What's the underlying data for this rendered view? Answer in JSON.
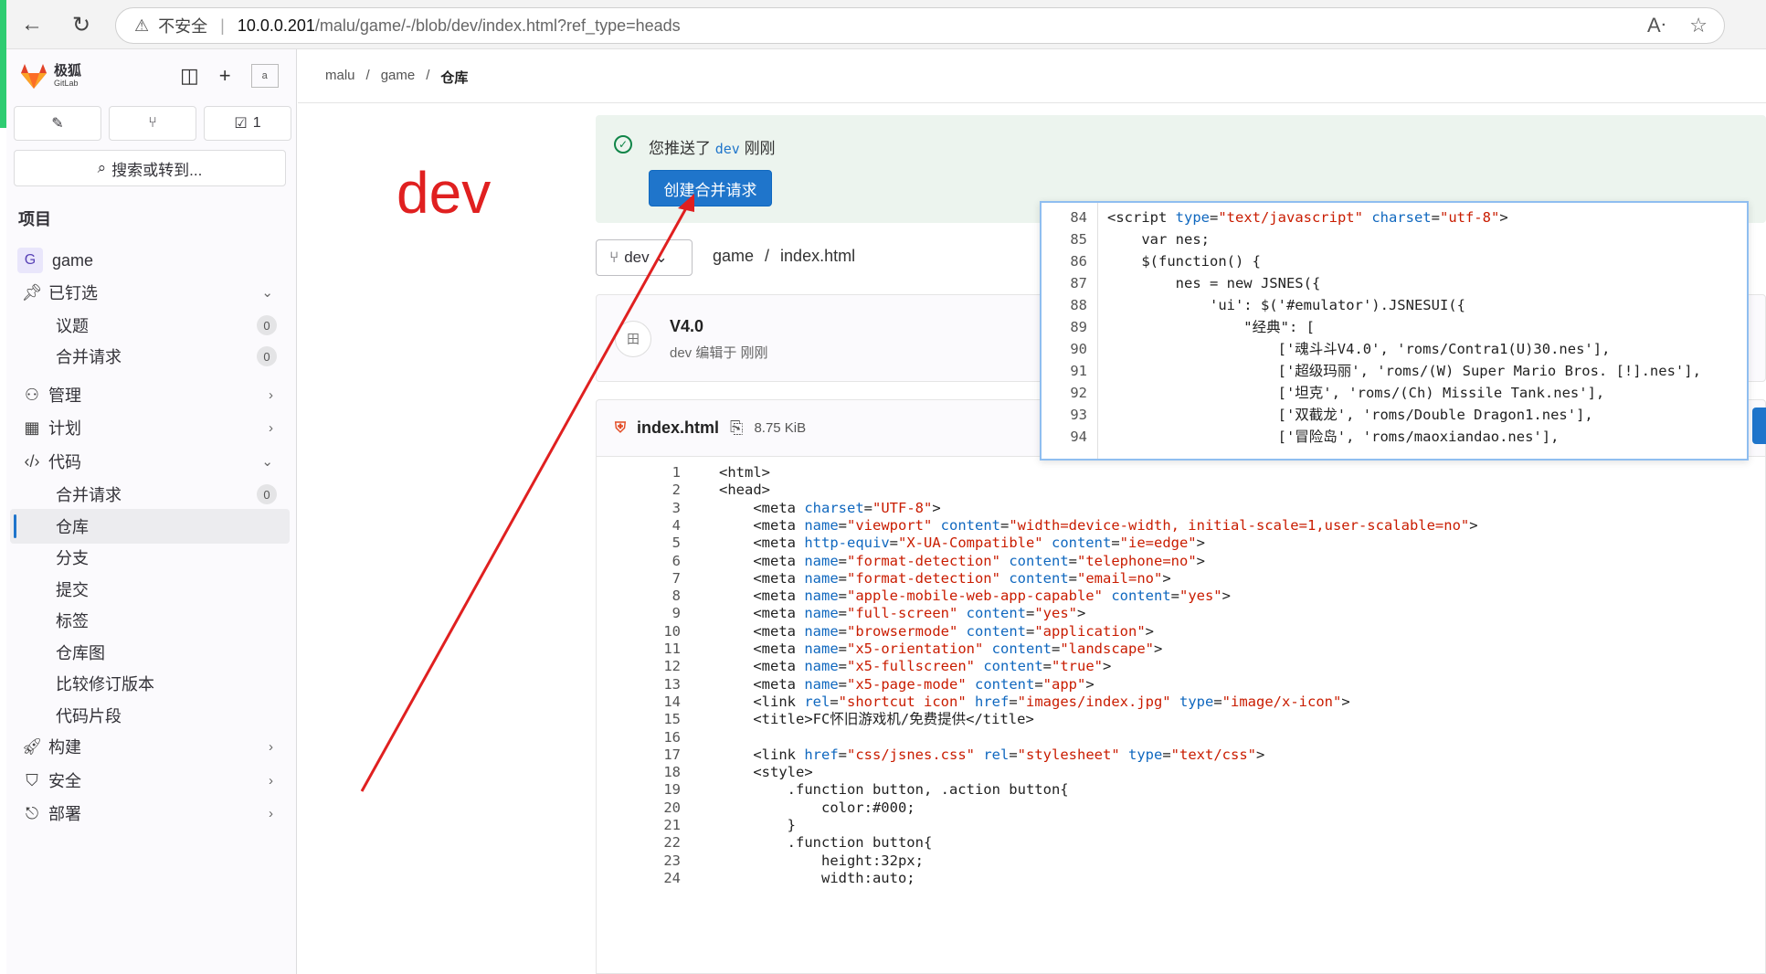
{
  "browser": {
    "insecure_label": "不安全",
    "url_host": "10.0.0.201",
    "url_path": "/malu/game/-/blob/dev/index.html?ref_type=heads"
  },
  "sidebar": {
    "brand_name": "极狐",
    "brand_sub": "GitLab",
    "avatar_alt": "a",
    "todo_count": "1",
    "search_label": "搜索或转到...",
    "section_title": "项目",
    "project_initial": "G",
    "project_name": "game",
    "items": [
      {
        "label": "已钉选",
        "icon": "pin-icon",
        "chev": "⌄"
      },
      {
        "label": "议题",
        "badge": "0"
      },
      {
        "label": "合并请求",
        "badge": "0"
      },
      {
        "label": "管理",
        "icon": "users-icon",
        "chev": "›"
      },
      {
        "label": "计划",
        "icon": "calendar-icon",
        "chev": "›"
      },
      {
        "label": "代码",
        "icon": "code-icon",
        "chev": "⌄"
      },
      {
        "label": "合并请求",
        "badge": "0"
      },
      {
        "label": "仓库"
      },
      {
        "label": "分支"
      },
      {
        "label": "提交"
      },
      {
        "label": "标签"
      },
      {
        "label": "仓库图"
      },
      {
        "label": "比较修订版本"
      },
      {
        "label": "代码片段"
      },
      {
        "label": "构建",
        "icon": "rocket-icon",
        "chev": "›"
      },
      {
        "label": "安全",
        "icon": "shield-icon",
        "chev": "›"
      },
      {
        "label": "部署",
        "icon": "deploy-icon",
        "chev": "›"
      }
    ]
  },
  "breadcrumb": {
    "a": "malu",
    "b": "game",
    "c": "仓库"
  },
  "alert": {
    "prefix": "您推送了",
    "branch": "dev",
    "suffix": "刚刚",
    "button": "创建合并请求"
  },
  "annotation": {
    "text": "dev"
  },
  "branch_selector": {
    "label": "dev"
  },
  "file_path": {
    "project": "game",
    "file": "index.html"
  },
  "commit": {
    "avatar_alt": "田",
    "title": "V4.0",
    "meta": "dev 编辑于 刚刚"
  },
  "file": {
    "name": "index.html",
    "size": "8.75 KiB"
  },
  "overlay_lines": [
    {
      "n": "84",
      "text": "<script type=\"text/javascript\" charset=\"utf-8\">"
    },
    {
      "n": "85",
      "text": "    var nes;"
    },
    {
      "n": "86",
      "text": "    $(function() {"
    },
    {
      "n": "87",
      "text": "        nes = new JSNES({"
    },
    {
      "n": "88",
      "text": "            'ui': $('#emulator').JSNESUI({"
    },
    {
      "n": "89",
      "text": "                \"经典\": ["
    },
    {
      "n": "90",
      "text": "                    ['魂斗斗V4.0', 'roms/Contra1(U)30.nes'],"
    },
    {
      "n": "91",
      "text": "                    ['超级玛丽', 'roms/(W) Super Mario Bros. [!].nes'],"
    },
    {
      "n": "92",
      "text": "                    ['坦克', 'roms/(Ch) Missile Tank.nes'],"
    },
    {
      "n": "93",
      "text": "                    ['双截龙', 'roms/Double Dragon1.nes'],"
    },
    {
      "n": "94",
      "text": "                    ['冒险岛', 'roms/maoxiandao.nes'],"
    }
  ],
  "code_lines": [
    {
      "n": "1",
      "text": "<html>"
    },
    {
      "n": "2",
      "text": "<head>"
    },
    {
      "n": "3",
      "text": "    <meta charset=\"UTF-8\">"
    },
    {
      "n": "4",
      "text": "    <meta name=\"viewport\" content=\"width=device-width, initial-scale=1,user-scalable=no\">"
    },
    {
      "n": "5",
      "text": "    <meta http-equiv=\"X-UA-Compatible\" content=\"ie=edge\">"
    },
    {
      "n": "6",
      "text": "    <meta name=\"format-detection\" content=\"telephone=no\">"
    },
    {
      "n": "7",
      "text": "    <meta name=\"format-detection\" content=\"email=no\">"
    },
    {
      "n": "8",
      "text": "    <meta name=\"apple-mobile-web-app-capable\" content=\"yes\">"
    },
    {
      "n": "9",
      "text": "    <meta name=\"full-screen\" content=\"yes\">"
    },
    {
      "n": "10",
      "text": "    <meta name=\"browsermode\" content=\"application\">"
    },
    {
      "n": "11",
      "text": "    <meta name=\"x5-orientation\" content=\"landscape\">"
    },
    {
      "n": "12",
      "text": "    <meta name=\"x5-fullscreen\" content=\"true\">"
    },
    {
      "n": "13",
      "text": "    <meta name=\"x5-page-mode\" content=\"app\">"
    },
    {
      "n": "14",
      "text": "    <link rel=\"shortcut icon\" href=\"images/index.jpg\" type=\"image/x-icon\">"
    },
    {
      "n": "15",
      "text": "    <title>FC怀旧游戏机/免费提供</title>"
    },
    {
      "n": "16",
      "text": ""
    },
    {
      "n": "17",
      "text": "    <link href=\"css/jsnes.css\" rel=\"stylesheet\" type=\"text/css\">"
    },
    {
      "n": "18",
      "text": "    <style>"
    },
    {
      "n": "19",
      "text": "        .function button, .action button{"
    },
    {
      "n": "20",
      "text": "            color:#000;"
    },
    {
      "n": "21",
      "text": "        }"
    },
    {
      "n": "22",
      "text": "        .function button{"
    },
    {
      "n": "23",
      "text": "            height:32px;"
    },
    {
      "n": "24",
      "text": "            width:auto;"
    }
  ]
}
